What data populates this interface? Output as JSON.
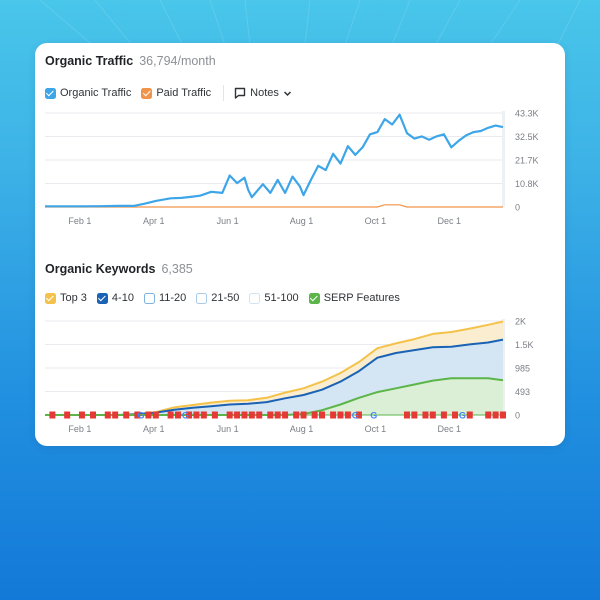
{
  "traffic": {
    "title": "Organic Traffic",
    "metric": "36,794/month",
    "legend": [
      {
        "label": "Organic Traffic",
        "checked": true,
        "color": "#3ea6e8"
      },
      {
        "label": "Paid Traffic",
        "checked": true,
        "color": "#f0944a"
      }
    ],
    "notes": {
      "label": "Notes",
      "icon": "comment-icon",
      "dropdown_icon": "chevron-down-icon"
    }
  },
  "keywords": {
    "title": "Organic Keywords",
    "metric": "6,385",
    "legend": [
      {
        "label": "Top 3",
        "checked": true,
        "color": "#f4c24a"
      },
      {
        "label": "4-10",
        "checked": true,
        "color": "#1a62b5"
      },
      {
        "label": "11-20",
        "checked": false,
        "color": "#7fb3e0"
      },
      {
        "label": "21-50",
        "checked": false,
        "color": "#a9cbe8"
      },
      {
        "label": "51-100",
        "checked": false,
        "color": "#d2e4f3"
      },
      {
        "label": "SERP Features",
        "checked": true,
        "color": "#5bb548"
      }
    ]
  },
  "chart_data": [
    {
      "type": "line",
      "title": "Organic Traffic",
      "x_tick_labels": [
        "Feb 1",
        "Apr 1",
        "Jun 1",
        "Aug 1",
        "Oct 1",
        "Dec 1"
      ],
      "y_tick_labels": [
        "0",
        "10.8K",
        "21.7K",
        "32.5K",
        "43.3K"
      ],
      "ylim": [
        0,
        43300
      ],
      "y_axis_side": "right",
      "grid": true,
      "x_months": [
        0.0,
        0.5,
        1.0,
        1.5,
        2.0,
        2.4,
        2.7,
        3.0,
        3.4,
        3.7,
        4.0,
        4.2,
        4.5,
        4.8,
        5.0,
        5.2,
        5.4,
        5.5,
        5.6,
        5.7,
        5.9,
        6.1,
        6.3,
        6.5,
        6.7,
        6.9,
        7.0,
        7.2,
        7.4,
        7.6,
        7.8,
        8.0,
        8.2,
        8.4,
        8.6,
        8.8,
        9.0,
        9.2,
        9.4,
        9.6,
        9.8,
        10.0,
        10.2,
        10.4,
        10.6,
        10.8,
        11.0,
        11.2,
        11.4,
        11.6,
        11.8,
        12.0,
        12.2,
        12.4
      ],
      "series": [
        {
          "name": "Organic Traffic",
          "color": "#3ea6e8",
          "values": [
            300,
            300,
            300,
            350,
            500,
            500,
            1500,
            2800,
            4000,
            4200,
            4800,
            5200,
            7000,
            6500,
            14500,
            11000,
            13500,
            8000,
            4500,
            6500,
            10500,
            6500,
            12500,
            6500,
            14000,
            9500,
            5500,
            12500,
            19000,
            17000,
            24500,
            20000,
            28000,
            24000,
            27500,
            33500,
            34500,
            40500,
            38000,
            42500,
            34000,
            31500,
            32500,
            31000,
            32500,
            33500,
            27500,
            30500,
            33000,
            34500,
            35000,
            36500,
            37500,
            36800
          ]
        },
        {
          "name": "Paid Traffic",
          "color": "#f0944a",
          "values": [
            0,
            0,
            0,
            0,
            0,
            0,
            0,
            0,
            0,
            0,
            0,
            0,
            0,
            0,
            0,
            0,
            0,
            0,
            0,
            0,
            0,
            0,
            0,
            0,
            0,
            0,
            0,
            0,
            0,
            0,
            0,
            0,
            0,
            0,
            0,
            0,
            0,
            1000,
            1000,
            1000,
            0,
            0,
            0,
            0,
            0,
            0,
            0,
            0,
            0,
            0,
            0,
            0,
            0,
            0
          ]
        }
      ]
    },
    {
      "type": "area",
      "title": "Organic Keywords",
      "x_tick_labels": [
        "Feb 1",
        "Apr 1",
        "Jun 1",
        "Aug 1",
        "Oct 1",
        "Dec 1"
      ],
      "y_tick_labels": [
        "0",
        "493",
        "985",
        "1.5K",
        "2K"
      ],
      "ylim": [
        0,
        1970
      ],
      "y_axis_side": "right",
      "grid": true,
      "x_months": [
        0.0,
        1.0,
        2.0,
        2.5,
        3.0,
        3.5,
        4.0,
        4.5,
        5.0,
        5.5,
        6.0,
        6.5,
        7.0,
        7.5,
        8.0,
        8.5,
        9.0,
        9.5,
        10.0,
        10.5,
        11.0,
        11.5,
        12.0,
        12.4
      ],
      "series": [
        {
          "name": "Top 3",
          "color": "#f4c24a",
          "values": [
            0,
            0,
            0,
            20,
            60,
            160,
            210,
            260,
            300,
            310,
            360,
            470,
            560,
            700,
            880,
            1110,
            1400,
            1500,
            1590,
            1700,
            1740,
            1810,
            1890,
            1960
          ]
        },
        {
          "name": "4-10",
          "color": "#1a62b5",
          "values": [
            0,
            0,
            0,
            15,
            50,
            110,
            150,
            185,
            220,
            235,
            270,
            350,
            420,
            530,
            700,
            920,
            1200,
            1300,
            1360,
            1420,
            1430,
            1480,
            1520,
            1580
          ]
        },
        {
          "name": "SERP Features",
          "color": "#5bb548",
          "values": [
            0,
            0,
            0,
            0,
            0,
            0,
            0,
            0,
            0,
            0,
            0,
            0,
            20,
            100,
            220,
            360,
            480,
            560,
            640,
            720,
            770,
            770,
            770,
            730
          ]
        }
      ],
      "markers": {
        "description": "red SERP event flags and Google update markers along the baseline",
        "red_flag_x_months": [
          0.2,
          0.6,
          1.0,
          1.3,
          1.7,
          1.9,
          2.2,
          2.5,
          2.8,
          3.0,
          3.4,
          3.6,
          3.9,
          4.1,
          4.3,
          4.6,
          5.0,
          5.2,
          5.4,
          5.6,
          5.8,
          6.1,
          6.3,
          6.5,
          6.8,
          7.0,
          7.3,
          7.5,
          7.8,
          8.0,
          8.2,
          8.5,
          9.8,
          10.0,
          10.3,
          10.5,
          10.8,
          11.1,
          11.5,
          12.0,
          12.2,
          12.4
        ],
        "google_x_months": [
          2.6,
          3.8,
          8.4,
          8.9,
          11.3
        ]
      }
    }
  ]
}
